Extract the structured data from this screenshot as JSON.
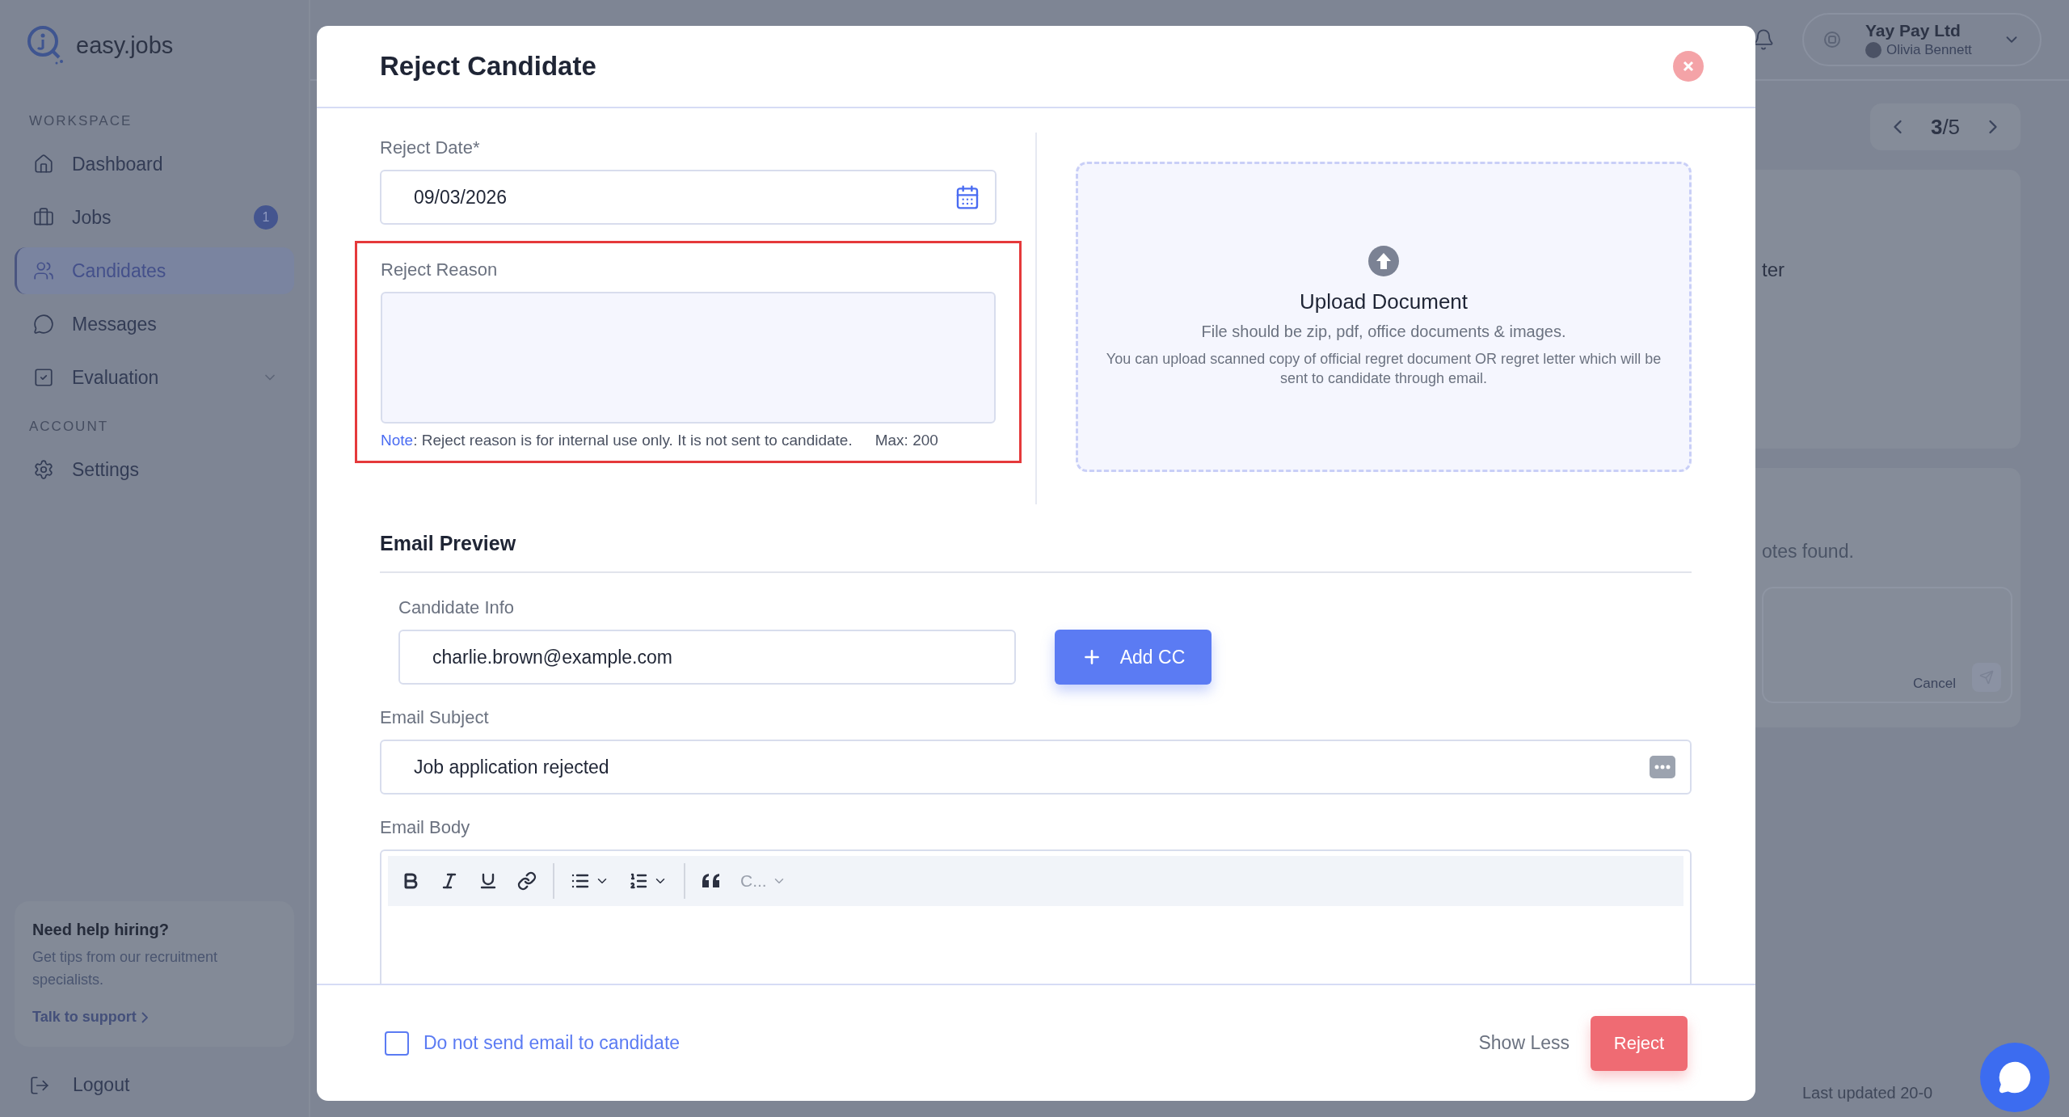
{
  "sidebar": {
    "logo": "easy.jobs",
    "sections": [
      {
        "title": "WORKSPACE",
        "items": [
          {
            "label": "Dashboard",
            "kind": "home",
            "selected": false
          },
          {
            "label": "Jobs",
            "kind": "briefcase",
            "selected": false,
            "badge": "1"
          },
          {
            "label": "Candidates",
            "kind": "users",
            "selected": true
          },
          {
            "label": "Messages",
            "kind": "message",
            "selected": false
          },
          {
            "label": "Evaluation",
            "kind": "check",
            "selected": false,
            "expandable": true
          }
        ]
      },
      {
        "title": "ACCOUNT",
        "items": [
          {
            "label": "Settings",
            "kind": "settings",
            "selected": false
          }
        ]
      }
    ],
    "help": {
      "title": "Need help hiring?",
      "text": "Get tips from our recruitment specialists.",
      "link": "Talk to support"
    },
    "logout": "Logout"
  },
  "header": {
    "company": "Yay Pay Ltd",
    "user": "Olivia Bennett"
  },
  "pager": "**3**/5",
  "background": {
    "card_text": "ter",
    "notes_text": "otes found.",
    "cancel": "Cancel",
    "last_updated": "Last updated 20-0"
  },
  "modal": {
    "title": "Reject Candidate",
    "reject_date": {
      "label": "Reject Date*",
      "value": "09/03/2026"
    },
    "reject_reason": {
      "label": "Reject Reason",
      "highlighted": true,
      "note_label": "Note",
      "note": ": Reject reason is for internal use only. It is not sent to candidate.",
      "max": "Max: 200"
    },
    "upload": {
      "title": "Upload Document",
      "hint": "File should be zip, pdf, office documents & images.",
      "description": "You can upload scanned copy of official regret document OR regret letter which will be sent to candidate through email."
    },
    "email_preview": {
      "title": "Email Preview",
      "candidate_info": {
        "label": "Candidate Info",
        "value": "charlie.brown@example.com"
      },
      "add_cc": "Add CC",
      "subject": {
        "label": "Email Subject",
        "value": "Job application rejected"
      },
      "body": {
        "label": "Email Body",
        "toolbar": [
          {
            "kind": "bold"
          },
          {
            "kind": "italic"
          },
          {
            "kind": "underline"
          },
          {
            "kind": "link"
          },
          {
            "kind": "separator"
          },
          {
            "kind": "bullet-list"
          },
          {
            "kind": "numbered-list"
          },
          {
            "kind": "separator"
          },
          {
            "kind": "quote"
          },
          {
            "kind": "heading",
            "label": "C..."
          }
        ]
      }
    }
  },
  "footer": {
    "no_email": {
      "label": "Do not send email to candidate",
      "checked": false
    },
    "show_less": "Show Less",
    "reject": "Reject"
  }
}
